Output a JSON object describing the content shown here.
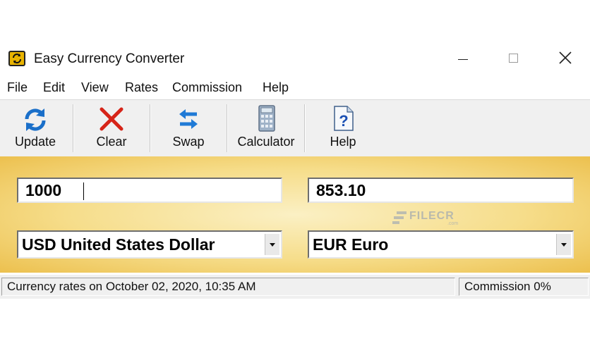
{
  "window": {
    "title": "Easy Currency Converter",
    "icon": "app-convert-icon"
  },
  "menu": [
    "File",
    "Edit",
    "View",
    "Rates",
    "Commission",
    "Help"
  ],
  "toolbar": {
    "update_label": "Update",
    "clear_label": "Clear",
    "swap_label": "Swap",
    "calculator_label": "Calculator",
    "help_label": "Help"
  },
  "converter": {
    "amount_value": "1000",
    "result_value": "853.10",
    "from_currency": "USD United States Dollar",
    "to_currency": "EUR Euro"
  },
  "watermark": {
    "text": "FILECR",
    "suffix": ".com"
  },
  "status": {
    "rates_text": "Currency rates on October 02, 2020, 10:35 AM",
    "commission_text": "Commission 0%"
  },
  "colors": {
    "panel_center": "#fbf0c4",
    "panel_edge": "#ecc04e",
    "update_icon": "#1a6fc9",
    "clear_icon": "#d62418",
    "swap_icon": "#1f7ad6"
  }
}
